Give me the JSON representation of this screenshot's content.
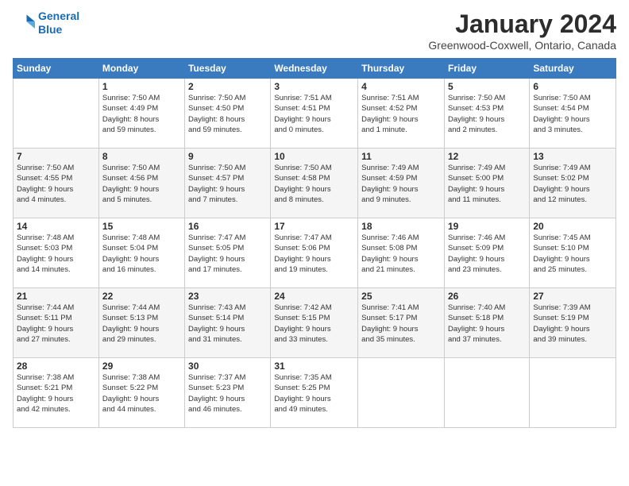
{
  "logo": {
    "line1": "General",
    "line2": "Blue"
  },
  "title": "January 2024",
  "location": "Greenwood-Coxwell, Ontario, Canada",
  "days_of_week": [
    "Sunday",
    "Monday",
    "Tuesday",
    "Wednesday",
    "Thursday",
    "Friday",
    "Saturday"
  ],
  "weeks": [
    [
      {
        "day": "",
        "info": ""
      },
      {
        "day": "1",
        "info": "Sunrise: 7:50 AM\nSunset: 4:49 PM\nDaylight: 8 hours\nand 59 minutes."
      },
      {
        "day": "2",
        "info": "Sunrise: 7:50 AM\nSunset: 4:50 PM\nDaylight: 8 hours\nand 59 minutes."
      },
      {
        "day": "3",
        "info": "Sunrise: 7:51 AM\nSunset: 4:51 PM\nDaylight: 9 hours\nand 0 minutes."
      },
      {
        "day": "4",
        "info": "Sunrise: 7:51 AM\nSunset: 4:52 PM\nDaylight: 9 hours\nand 1 minute."
      },
      {
        "day": "5",
        "info": "Sunrise: 7:50 AM\nSunset: 4:53 PM\nDaylight: 9 hours\nand 2 minutes."
      },
      {
        "day": "6",
        "info": "Sunrise: 7:50 AM\nSunset: 4:54 PM\nDaylight: 9 hours\nand 3 minutes."
      }
    ],
    [
      {
        "day": "7",
        "info": "Sunrise: 7:50 AM\nSunset: 4:55 PM\nDaylight: 9 hours\nand 4 minutes."
      },
      {
        "day": "8",
        "info": "Sunrise: 7:50 AM\nSunset: 4:56 PM\nDaylight: 9 hours\nand 5 minutes."
      },
      {
        "day": "9",
        "info": "Sunrise: 7:50 AM\nSunset: 4:57 PM\nDaylight: 9 hours\nand 7 minutes."
      },
      {
        "day": "10",
        "info": "Sunrise: 7:50 AM\nSunset: 4:58 PM\nDaylight: 9 hours\nand 8 minutes."
      },
      {
        "day": "11",
        "info": "Sunrise: 7:49 AM\nSunset: 4:59 PM\nDaylight: 9 hours\nand 9 minutes."
      },
      {
        "day": "12",
        "info": "Sunrise: 7:49 AM\nSunset: 5:00 PM\nDaylight: 9 hours\nand 11 minutes."
      },
      {
        "day": "13",
        "info": "Sunrise: 7:49 AM\nSunset: 5:02 PM\nDaylight: 9 hours\nand 12 minutes."
      }
    ],
    [
      {
        "day": "14",
        "info": "Sunrise: 7:48 AM\nSunset: 5:03 PM\nDaylight: 9 hours\nand 14 minutes."
      },
      {
        "day": "15",
        "info": "Sunrise: 7:48 AM\nSunset: 5:04 PM\nDaylight: 9 hours\nand 16 minutes."
      },
      {
        "day": "16",
        "info": "Sunrise: 7:47 AM\nSunset: 5:05 PM\nDaylight: 9 hours\nand 17 minutes."
      },
      {
        "day": "17",
        "info": "Sunrise: 7:47 AM\nSunset: 5:06 PM\nDaylight: 9 hours\nand 19 minutes."
      },
      {
        "day": "18",
        "info": "Sunrise: 7:46 AM\nSunset: 5:08 PM\nDaylight: 9 hours\nand 21 minutes."
      },
      {
        "day": "19",
        "info": "Sunrise: 7:46 AM\nSunset: 5:09 PM\nDaylight: 9 hours\nand 23 minutes."
      },
      {
        "day": "20",
        "info": "Sunrise: 7:45 AM\nSunset: 5:10 PM\nDaylight: 9 hours\nand 25 minutes."
      }
    ],
    [
      {
        "day": "21",
        "info": "Sunrise: 7:44 AM\nSunset: 5:11 PM\nDaylight: 9 hours\nand 27 minutes."
      },
      {
        "day": "22",
        "info": "Sunrise: 7:44 AM\nSunset: 5:13 PM\nDaylight: 9 hours\nand 29 minutes."
      },
      {
        "day": "23",
        "info": "Sunrise: 7:43 AM\nSunset: 5:14 PM\nDaylight: 9 hours\nand 31 minutes."
      },
      {
        "day": "24",
        "info": "Sunrise: 7:42 AM\nSunset: 5:15 PM\nDaylight: 9 hours\nand 33 minutes."
      },
      {
        "day": "25",
        "info": "Sunrise: 7:41 AM\nSunset: 5:17 PM\nDaylight: 9 hours\nand 35 minutes."
      },
      {
        "day": "26",
        "info": "Sunrise: 7:40 AM\nSunset: 5:18 PM\nDaylight: 9 hours\nand 37 minutes."
      },
      {
        "day": "27",
        "info": "Sunrise: 7:39 AM\nSunset: 5:19 PM\nDaylight: 9 hours\nand 39 minutes."
      }
    ],
    [
      {
        "day": "28",
        "info": "Sunrise: 7:38 AM\nSunset: 5:21 PM\nDaylight: 9 hours\nand 42 minutes."
      },
      {
        "day": "29",
        "info": "Sunrise: 7:38 AM\nSunset: 5:22 PM\nDaylight: 9 hours\nand 44 minutes."
      },
      {
        "day": "30",
        "info": "Sunrise: 7:37 AM\nSunset: 5:23 PM\nDaylight: 9 hours\nand 46 minutes."
      },
      {
        "day": "31",
        "info": "Sunrise: 7:35 AM\nSunset: 5:25 PM\nDaylight: 9 hours\nand 49 minutes."
      },
      {
        "day": "",
        "info": ""
      },
      {
        "day": "",
        "info": ""
      },
      {
        "day": "",
        "info": ""
      }
    ]
  ]
}
